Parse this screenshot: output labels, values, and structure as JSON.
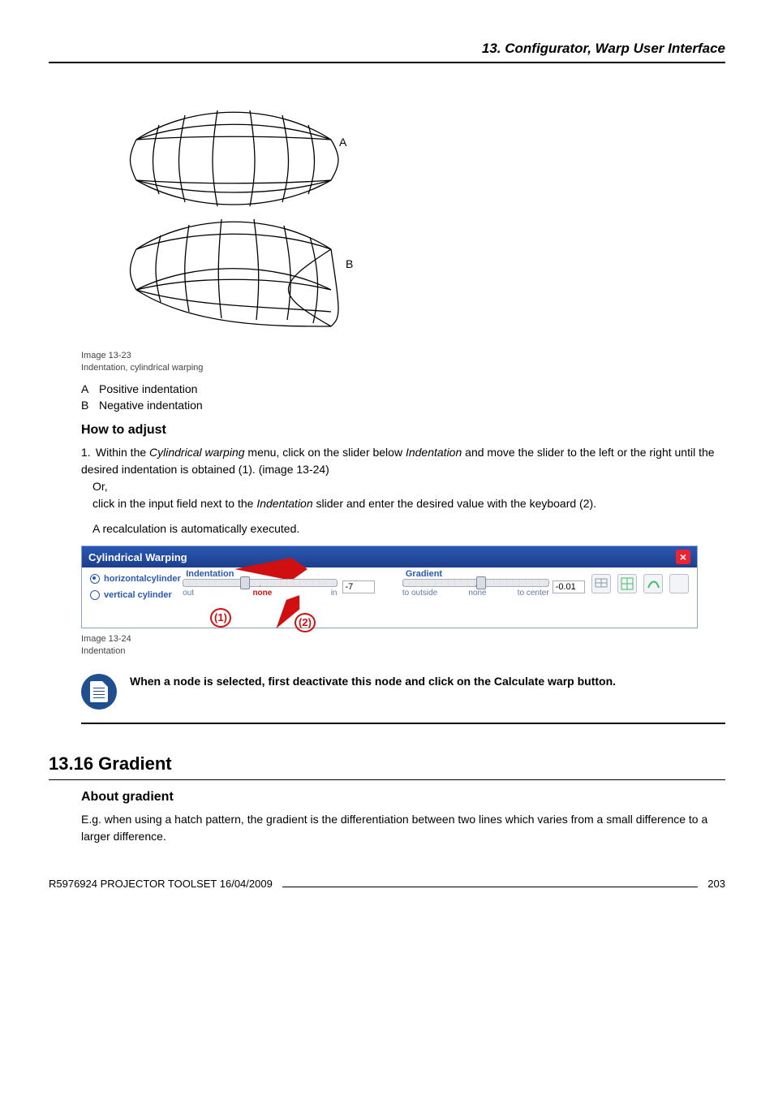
{
  "header": {
    "title": "13. Configurator, Warp User Interface"
  },
  "figure1": {
    "labelA": "A",
    "labelB": "B",
    "caption_line1": "Image 13-23",
    "caption_line2": "Indentation, cylindrical warping",
    "legendA_code": "A",
    "legendA_text": "Positive indentation",
    "legendB_code": "B",
    "legendB_text": "Negative indentation"
  },
  "howto": {
    "heading": "How to adjust",
    "step_num": "1.",
    "step_line1a": "Within the ",
    "step_line1_em": "Cylindrical warping",
    "step_line1b": " menu, click on the slider below ",
    "step_line1_em2": "Indentation",
    "step_line1c": " and move the slider to the left or the right until the desired indentation is obtained (1). (image 13-24)",
    "step_or": "Or,",
    "step_line2a": "click in the input field next to the ",
    "step_line2_em": "Indentation",
    "step_line2b": " slider and enter the desired value with the keyboard (2).",
    "step_line3": "A recalculation is automatically executed."
  },
  "panel": {
    "title": "Cylindrical Warping",
    "orient_h": "horizontalcylinder",
    "orient_v": "vertical cylinder",
    "ind_label": "Indentation",
    "ind_left": "out",
    "ind_mid": "none",
    "ind_right": "in",
    "ind_value": "-7",
    "grad_label": "Gradient",
    "grad_left": "to outside",
    "grad_mid": "none",
    "grad_right": "to center",
    "grad_value": "-0.01",
    "callout1": "(1)",
    "callout2": "(2)"
  },
  "figure2": {
    "caption_line1": "Image 13-24",
    "caption_line2": "Indentation"
  },
  "note": {
    "text": "When a node is selected, first deactivate this node and click on the Calculate warp button."
  },
  "section": {
    "number_title": "13.16 Gradient",
    "sub": "About gradient",
    "para": "E.g. when using a hatch pattern, the gradient is the differentiation between two lines which varies from a small difference to a larger difference."
  },
  "footer": {
    "left": "R5976924 PROJECTOR TOOLSET 16/04/2009",
    "right": "203"
  },
  "chart_data": {
    "type": "table",
    "description": "Cylindrical Warping control panel state",
    "controls": [
      {
        "name": "orientation",
        "options": [
          "horizontalcylinder",
          "vertical cylinder"
        ],
        "selected": "horizontalcylinder"
      },
      {
        "name": "Indentation",
        "range_labels": [
          "out",
          "none",
          "in"
        ],
        "value": -7
      },
      {
        "name": "Gradient",
        "range_labels": [
          "to outside",
          "none",
          "to center"
        ],
        "value": -0.01
      }
    ]
  }
}
